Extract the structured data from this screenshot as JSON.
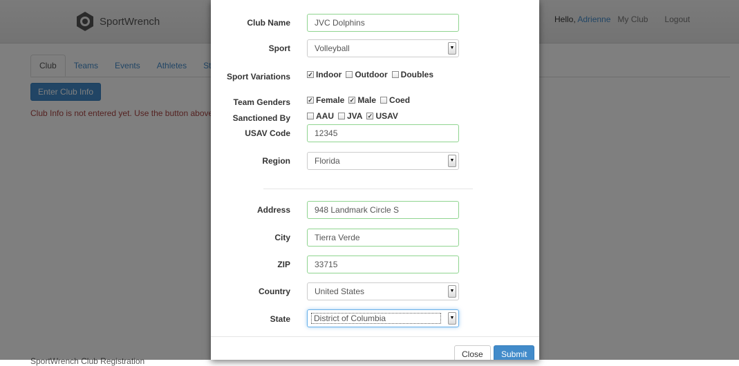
{
  "app": {
    "brand": "SportWrench"
  },
  "header": {
    "hello": "Hello,",
    "user": "Adrienne",
    "my_club": "My Club",
    "logout": "Logout"
  },
  "tabs": [
    "Club",
    "Teams",
    "Events",
    "Athletes",
    "St"
  ],
  "page": {
    "enter_button": "Enter Club Info",
    "message": "Club Info is not entered yet. Use the button above to",
    "bottom_text": "SportWrench Club Registration"
  },
  "form": {
    "club_name": {
      "label": "Club Name",
      "value": "JVC Dolphins"
    },
    "sport": {
      "label": "Sport",
      "value": "Volleyball"
    },
    "sport_variations": {
      "label": "Sport Variations",
      "options": [
        {
          "label": "Indoor",
          "checked": true
        },
        {
          "label": "Outdoor",
          "checked": false
        },
        {
          "label": "Doubles",
          "checked": false
        }
      ]
    },
    "team_genders": {
      "label": "Team Genders",
      "options": [
        {
          "label": "Female",
          "checked": true
        },
        {
          "label": "Male",
          "checked": true
        },
        {
          "label": "Coed",
          "checked": false
        }
      ]
    },
    "sanctioned_by": {
      "label": "Sanctioned By",
      "options": [
        {
          "label": "AAU",
          "checked": false
        },
        {
          "label": "JVA",
          "checked": false
        },
        {
          "label": "USAV",
          "checked": true
        }
      ]
    },
    "usav_code": {
      "label": "USAV Code",
      "value": "12345"
    },
    "region": {
      "label": "Region",
      "value": "Florida"
    },
    "address": {
      "label": "Address",
      "value": "948 Landmark Circle S"
    },
    "city": {
      "label": "City",
      "value": "Tierra Verde"
    },
    "zip": {
      "label": "ZIP",
      "value": "33715"
    },
    "country": {
      "label": "Country",
      "value": "United States"
    },
    "state": {
      "label": "State",
      "value": "District of Columbia"
    }
  },
  "footer": {
    "close": "Close",
    "submit": "Submit"
  },
  "colors": {
    "primary": "#428bca",
    "valid_border": "#8fd48f",
    "error_text": "#a94442"
  }
}
